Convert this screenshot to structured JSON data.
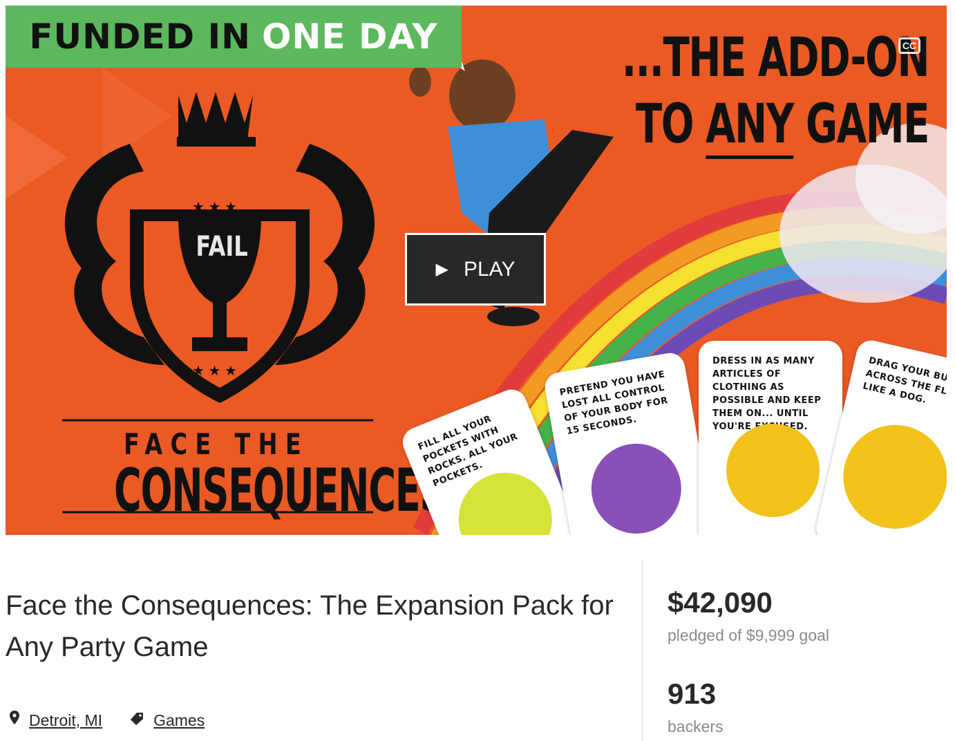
{
  "video": {
    "banner": {
      "part1": "FUNDED IN",
      "part2": "ONE DAY"
    },
    "headline": {
      "line1": "...THE ADD-ON",
      "line2_pre": "TO ",
      "line2_underlined": "ANY",
      "line2_post": " GAME"
    },
    "cc_label": "CC",
    "play_label": "PLAY",
    "logo": {
      "trophy_label": "FAIL",
      "line1": "FACE THE",
      "line2": "CONSEQUENCES"
    },
    "cards": [
      {
        "text": "Fill all your pockets with rocks. All your pockets."
      },
      {
        "text": "Pretend you have lost all control of your body for 15 seconds."
      },
      {
        "text": "Dress in as many articles of clothing as possible and keep them on... until you're excused."
      },
      {
        "text": "Drag your butt across the floor like a dog."
      }
    ],
    "colors": {
      "background": "#eb5a24",
      "banner": "#5cb85c",
      "play_bg": "#282828"
    }
  },
  "project": {
    "title": "Face the Consequences: The Expansion Pack for Any Party Game",
    "location": "Detroit, MI",
    "category": "Games",
    "location_icon": "map-pin-icon",
    "category_icon": "tag-icon"
  },
  "stats": {
    "pledged": "$42,090",
    "pledged_label": "pledged of $9,999 goal",
    "backers": "913",
    "backers_label": "backers"
  }
}
